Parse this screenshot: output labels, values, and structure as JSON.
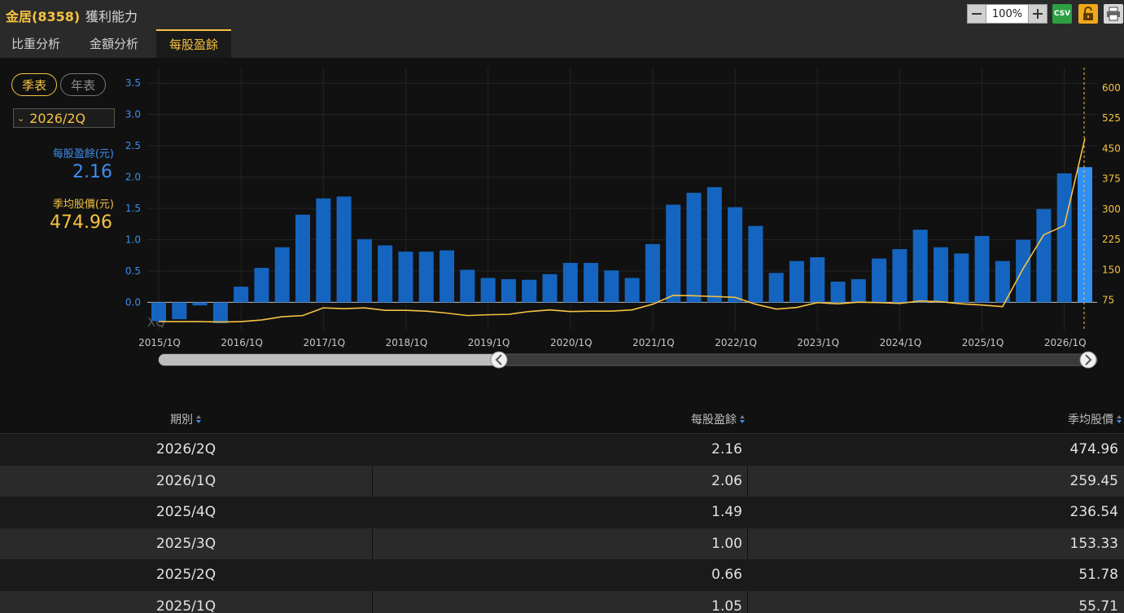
{
  "header": {
    "stock": "金居(8358)",
    "page_title": "獲利能力",
    "zoom_level": "100%",
    "csv_label": "CSV"
  },
  "tabs": [
    {
      "label": "比重分析",
      "active": false
    },
    {
      "label": "金額分析",
      "active": false
    },
    {
      "label": "每股盈餘",
      "active": true
    }
  ],
  "controls": {
    "period_quarterly": "季表",
    "period_annual": "年表",
    "selected_quarter": "2026/2Q"
  },
  "legend": {
    "eps_label": "每股盈餘(元)",
    "eps_value": "2.16",
    "price_label": "季均股價(元)",
    "price_value": "474.96"
  },
  "colors": {
    "accent": "#f5c242",
    "eps_bar": "#1565c0",
    "eps_bar_highlight": "#2f8ff5",
    "price_line": "#f5c242",
    "eps_axis": "#3d8ef0"
  },
  "chart_data": {
    "type": "bar",
    "watermark": "XQ",
    "x_tick_labels": [
      "2015/1Q",
      "2016/1Q",
      "2017/1Q",
      "2018/1Q",
      "2019/1Q",
      "2020/1Q",
      "2021/1Q",
      "2022/1Q",
      "2023/1Q",
      "2024/1Q",
      "2025/1Q",
      "2026/1Q"
    ],
    "left_axis": {
      "ticks": [
        "0.0",
        "0.5",
        "1.0",
        "1.5",
        "2.0",
        "2.5",
        "3.0",
        "3.5"
      ],
      "range": [
        -0.45,
        3.75
      ]
    },
    "right_axis": {
      "ticks": [
        "75",
        "150",
        "225",
        "300",
        "375",
        "450",
        "525",
        "600"
      ],
      "range": [
        0,
        650
      ]
    },
    "categories": [
      "2015/1Q",
      "2015/2Q",
      "2015/3Q",
      "2015/4Q",
      "2016/1Q",
      "2016/2Q",
      "2016/3Q",
      "2016/4Q",
      "2017/1Q",
      "2017/2Q",
      "2017/3Q",
      "2017/4Q",
      "2018/1Q",
      "2018/2Q",
      "2018/3Q",
      "2018/4Q",
      "2019/1Q",
      "2019/2Q",
      "2019/3Q",
      "2019/4Q",
      "2020/1Q",
      "2020/2Q",
      "2020/3Q",
      "2020/4Q",
      "2021/1Q",
      "2021/2Q",
      "2021/3Q",
      "2021/4Q",
      "2022/1Q",
      "2022/2Q",
      "2022/3Q",
      "2022/4Q",
      "2023/1Q",
      "2023/2Q",
      "2023/3Q",
      "2023/4Q",
      "2024/1Q",
      "2024/2Q",
      "2024/3Q",
      "2024/4Q",
      "2025/1Q",
      "2025/2Q",
      "2025/3Q",
      "2025/4Q",
      "2026/1Q",
      "2026/2Q"
    ],
    "series": [
      {
        "name": "每股盈餘",
        "type": "bar",
        "axis": "left",
        "values": [
          -0.3,
          -0.27,
          -0.05,
          -0.33,
          0.25,
          0.55,
          0.88,
          1.4,
          1.66,
          1.69,
          1.01,
          0.91,
          0.81,
          0.81,
          0.83,
          0.52,
          0.39,
          0.37,
          0.36,
          0.45,
          0.63,
          0.63,
          0.51,
          0.39,
          0.93,
          1.56,
          1.75,
          1.84,
          1.52,
          1.22,
          0.47,
          0.66,
          0.72,
          0.33,
          0.37,
          0.7,
          0.85,
          1.16,
          0.88,
          0.78,
          1.06,
          0.66,
          1.0,
          1.49,
          2.06,
          2.16
        ]
      },
      {
        "name": "季均股價",
        "type": "line",
        "axis": "right",
        "values": [
          22,
          22,
          22,
          21,
          22,
          26,
          34,
          37,
          56,
          54,
          56,
          50,
          50,
          48,
          43,
          37,
          39,
          40,
          47,
          51,
          47,
          48,
          48,
          51,
          65,
          87,
          86,
          84,
          82,
          65,
          53,
          57,
          69,
          66,
          70,
          69,
          67,
          73,
          71,
          66,
          63,
          59,
          153.33,
          236.54,
          259.45,
          474.96
        ]
      }
    ],
    "highlight_index": 45
  },
  "table": {
    "columns": [
      "期別",
      "每股盈餘",
      "季均股價"
    ],
    "rows": [
      [
        "2026/2Q",
        "2.16",
        "474.96"
      ],
      [
        "2026/1Q",
        "2.06",
        "259.45"
      ],
      [
        "2025/4Q",
        "1.49",
        "236.54"
      ],
      [
        "2025/3Q",
        "1.00",
        "153.33"
      ],
      [
        "2025/2Q",
        "0.66",
        "51.78"
      ],
      [
        "2025/1Q",
        "1.05",
        "55.71"
      ]
    ]
  }
}
